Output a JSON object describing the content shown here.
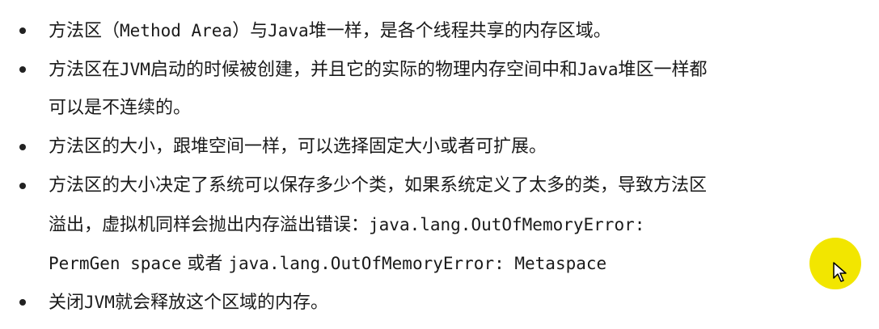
{
  "bullets": [
    {
      "lines": [
        [
          "方法区（",
          "Method Area",
          "）与",
          "Java",
          "堆一样，是各个线程共享的内存区域。"
        ]
      ]
    },
    {
      "lines": [
        [
          "方法区在",
          "JVM",
          "启动的时候被创建，并且它的实际的物理内存空间中和",
          "Java",
          "堆区一样都"
        ],
        [
          "可以是不连续的。"
        ]
      ]
    },
    {
      "lines": [
        [
          "方法区的大小，跟堆空间一样，可以选择固定大小或者可扩展。"
        ]
      ]
    },
    {
      "lines": [
        [
          "方法区的大小决定了系统可以保存多少个类，如果系统定义了太多的类，导致方法区"
        ],
        [
          "溢出，虚拟机同样会抛出内存溢出错误：",
          "java.lang.OutOfMemoryError:"
        ],
        [
          "PermGen space",
          " 或者 ",
          "java.lang.OutOfMemoryError: Metaspace"
        ]
      ]
    },
    {
      "lines": [
        [
          "关闭",
          "JVM",
          "就会释放这个区域的内存。"
        ]
      ]
    }
  ],
  "cursor": {
    "highlight_color": "#f2e600",
    "icon": "mouse-pointer-icon"
  }
}
